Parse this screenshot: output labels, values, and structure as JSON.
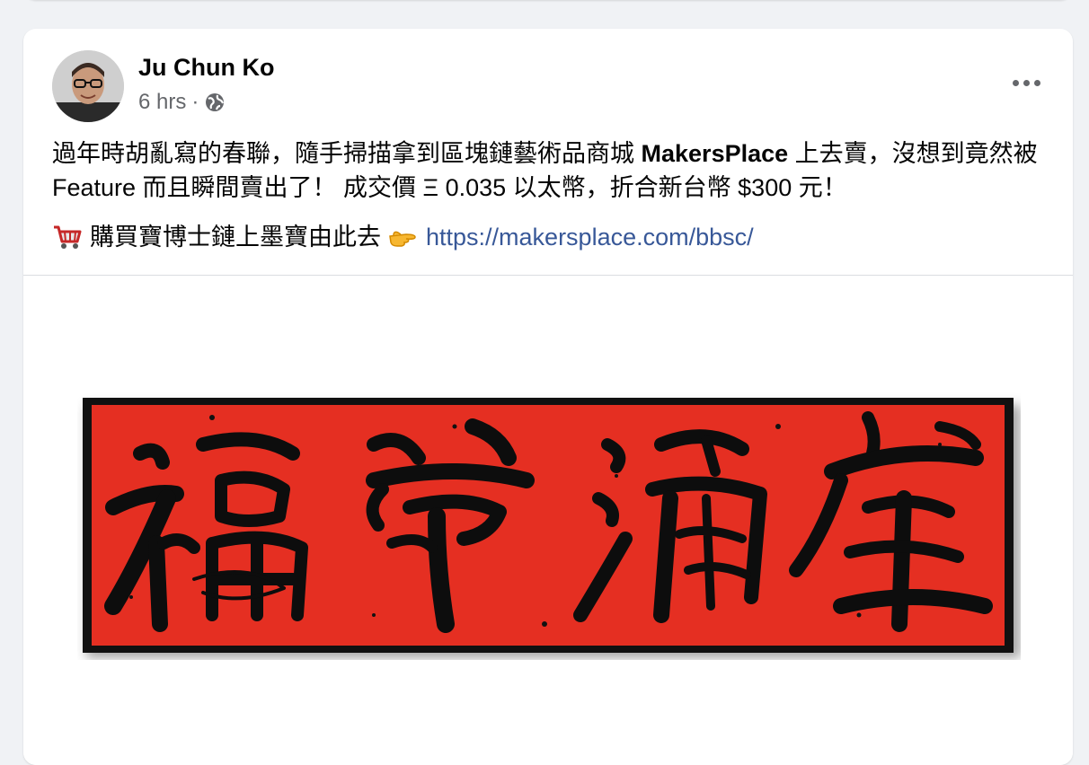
{
  "post": {
    "author": "Ju Chun Ko",
    "time": "6 hrs",
    "separator": "·",
    "text_part1": "過年時胡亂寫的春聯，隨手掃描拿到區塊鏈藝術品商城 ",
    "text_bold": "MakersPlace",
    "text_part2": " 上去賣，沒想到竟然被 Feature 而且瞬間賣出了！ 成交價 Ξ 0.035 以太幣，折合新台幣 $300 元！",
    "cta_text": "購買寶博士鏈上墨寶由此去",
    "link": "https://makersplace.com/bbsc/"
  },
  "icons": {
    "privacy": "globe-icon",
    "more": "more-options-icon",
    "cart": "shopping-cart-emoji",
    "pointer": "pointing-hand-emoji"
  },
  "colors": {
    "banner_red": "#e52f22",
    "banner_border": "#111111",
    "link": "#385898"
  }
}
